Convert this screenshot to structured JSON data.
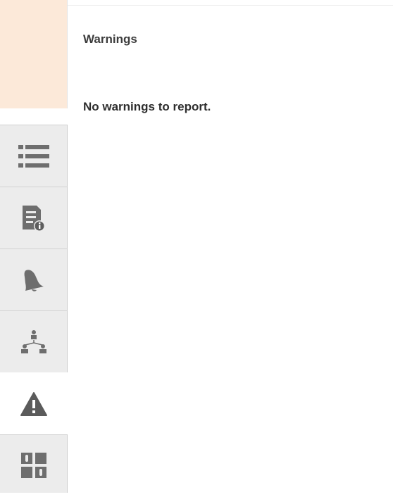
{
  "panel": {
    "title": "Warnings",
    "message": "No warnings to report."
  },
  "rail": {
    "tabs": [
      {
        "icon": "list-icon",
        "active": false
      },
      {
        "icon": "document-info-icon",
        "active": false
      },
      {
        "icon": "bell-icon",
        "active": false
      },
      {
        "icon": "hierarchy-icon",
        "active": false
      },
      {
        "icon": "warning-icon",
        "active": true
      },
      {
        "icon": "dashboard-icon",
        "active": false
      }
    ]
  },
  "colors": {
    "rail_highlight": "#fce9d9",
    "tab_background": "#ececec",
    "icon": "#6e6e6e",
    "text": "#3d3d3d"
  }
}
